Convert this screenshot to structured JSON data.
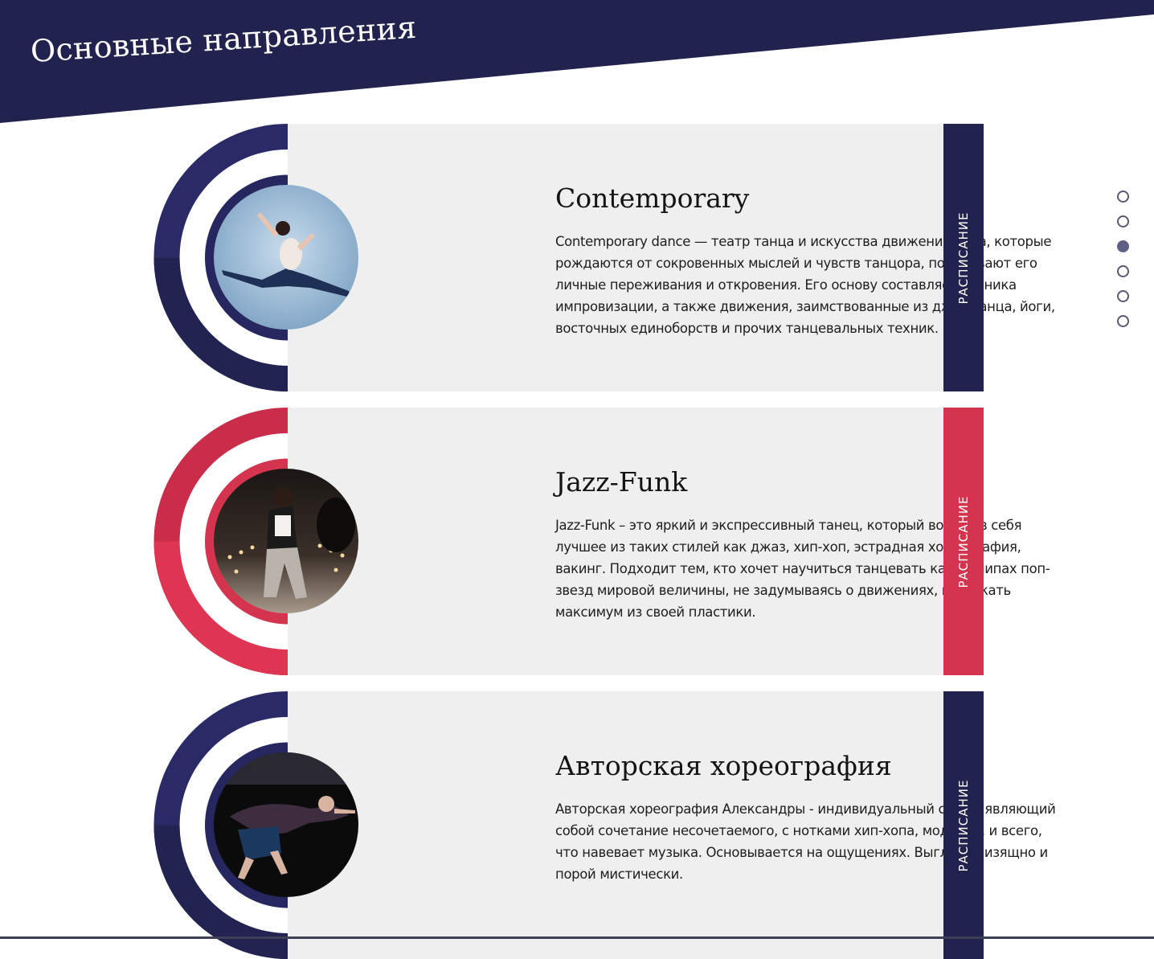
{
  "section": {
    "title": "Основные направления",
    "header_color": "#22224e"
  },
  "cards": [
    {
      "title": "Contemporary",
      "text": "Contemporary dance — театр танца и искусства движений тела, которые рождаются от сокровенных мыслей и чувств танцора, показывают его личные переживания и откровения. Его основу составляет техника импровизации, а также движения, заимствованные из джаз-танца, йоги, восточных единоборств и прочих танцевальных техник.",
      "tab_label": "РАСПИСАНИЕ",
      "accent": "#26275e",
      "photo": "contemporary-dancer-photo"
    },
    {
      "title": "Jazz-Funk",
      "text": "Jazz-Funk – это яркий и экспрессивный танец, который вобрал в себя лучшее из таких стилей как джаз, хип-хоп, эстрадная хореография, вакинг. Подходит тем, кто хочет научиться танцевать как в клипах поп-звезд мировой величины, не задумываясь о движениях, извлекать максимум из своей пластики.",
      "tab_label": "РАСПИСАНИЕ",
      "accent": "#d5344f",
      "photo": "jazz-funk-dancer-photo"
    },
    {
      "title": "Авторская хореография",
      "text": "Авторская хореография Александры - индивидуальный стиль, являющий собой сочетание несочетаемого, с нотками хип-хопа, модерна, и всего, что навевает музыка. Основывается на ощущениях. Выглядит изящно и порой мистически.",
      "tab_label": "РАСПИСАНИЕ",
      "accent": "#26275e",
      "photo": "author-choreography-dancer-photo"
    }
  ],
  "pager": {
    "count": 6,
    "active_index": 2
  }
}
